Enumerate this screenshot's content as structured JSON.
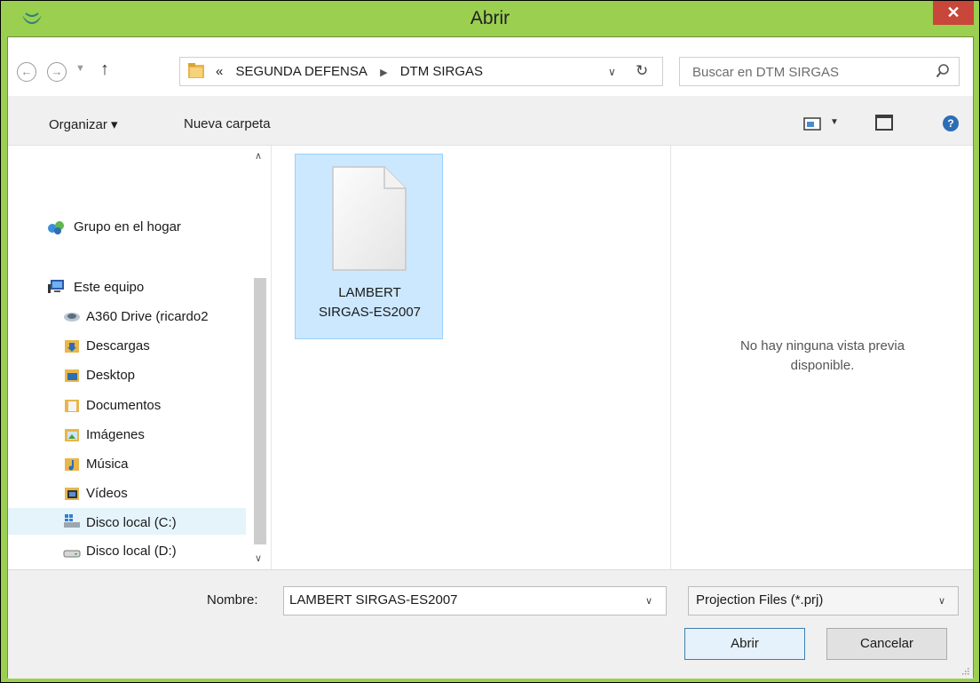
{
  "window": {
    "title": "Abrir",
    "close_label": "✕"
  },
  "nav": {
    "back_glyph": "←",
    "forward_glyph": "→",
    "recent_glyph": "▼",
    "up_glyph": "↑",
    "breadcrumb": {
      "overflow": "«",
      "items": [
        "SEGUNDA DEFENSA",
        "DTM SIRGAS"
      ],
      "separator": "▶"
    },
    "address_dropdown_glyph": "∨",
    "refresh_glyph": "↻",
    "search_placeholder": "Buscar en DTM SIRGAS"
  },
  "toolbar": {
    "organize_label": "Organizar ▾",
    "new_folder_label": "Nueva carpeta",
    "views_dropdown_glyph": "▼",
    "help_glyph": "?"
  },
  "sidebar": {
    "scroll_up": "∧",
    "scroll_down": "∨",
    "items": [
      {
        "label": "Grupo en el hogar",
        "icon": "homegroup-icon"
      },
      {
        "label": "Este equipo",
        "icon": "computer-icon"
      },
      {
        "label": "A360 Drive (ricardo2",
        "icon": "cloud-drive-icon"
      },
      {
        "label": "Descargas",
        "icon": "downloads-folder-icon"
      },
      {
        "label": "Desktop",
        "icon": "desktop-folder-icon"
      },
      {
        "label": "Documentos",
        "icon": "documents-folder-icon"
      },
      {
        "label": "Imágenes",
        "icon": "pictures-folder-icon"
      },
      {
        "label": "Música",
        "icon": "music-folder-icon"
      },
      {
        "label": "Vídeos",
        "icon": "videos-folder-icon"
      },
      {
        "label": "Disco local (C:)",
        "icon": "system-drive-icon"
      },
      {
        "label": "Disco local (D:)",
        "icon": "drive-icon"
      }
    ]
  },
  "files": [
    {
      "name_line1": "LAMBERT",
      "name_line2": "SIRGAS-ES2007",
      "selected": true
    }
  ],
  "preview": {
    "line1": "No hay ninguna vista previa",
    "line2": "disponible."
  },
  "footer": {
    "name_label": "Nombre:",
    "name_value": "LAMBERT SIRGAS-ES2007",
    "name_dropdown_glyph": "∨",
    "filter_value": "Projection Files (*.prj)",
    "filter_dropdown_glyph": "∨",
    "open_label": "Abrir",
    "cancel_label": "Cancelar"
  },
  "colors": {
    "frame": "#9bcf4f",
    "close": "#c8463a",
    "selection": "#cce8ff"
  }
}
